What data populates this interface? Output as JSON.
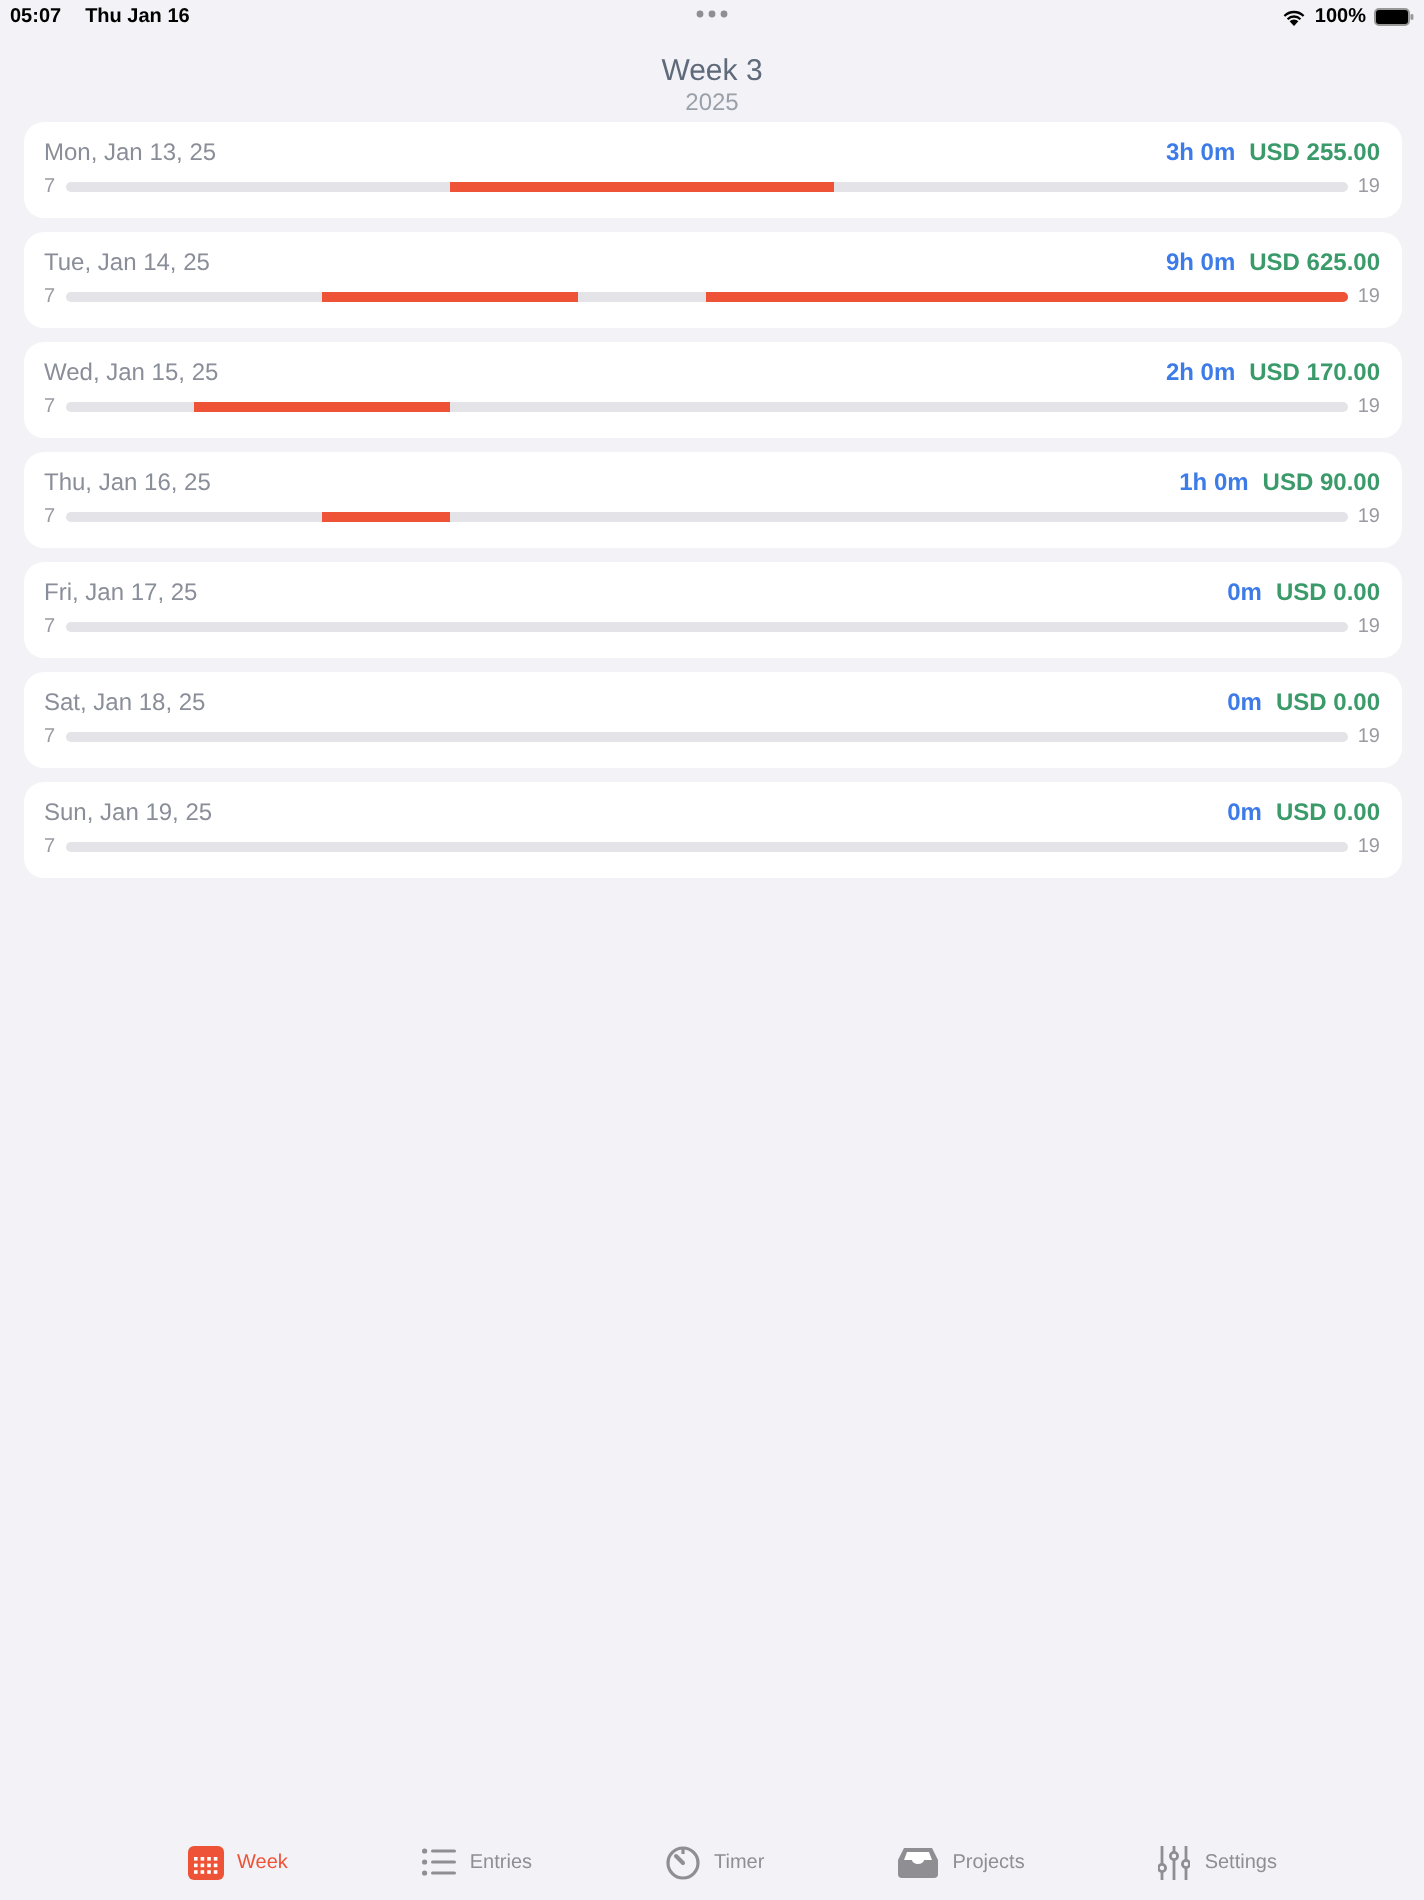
{
  "status_bar": {
    "time": "05:07",
    "date": "Thu Jan 16",
    "battery": "100%"
  },
  "header": {
    "title": "Week 3",
    "year": "2025"
  },
  "days": [
    {
      "date": "Mon, Jan 13, 25",
      "duration": "3h 0m",
      "amount": "USD 255.00",
      "start": "7",
      "end": "19",
      "slots": [
        false,
        false,
        false,
        true,
        true,
        true,
        false,
        false,
        false,
        false
      ]
    },
    {
      "date": "Tue, Jan 14, 25",
      "duration": "9h 0m",
      "amount": "USD 625.00",
      "start": "7",
      "end": "19",
      "slots": [
        false,
        false,
        true,
        true,
        false,
        true,
        true,
        true,
        true,
        true
      ]
    },
    {
      "date": "Wed, Jan 15, 25",
      "duration": "2h 0m",
      "amount": "USD 170.00",
      "start": "7",
      "end": "19",
      "slots": [
        false,
        true,
        true,
        false,
        false,
        false,
        false,
        false,
        false,
        false
      ]
    },
    {
      "date": "Thu, Jan 16, 25",
      "duration": "1h 0m",
      "amount": "USD 90.00",
      "start": "7",
      "end": "19",
      "slots": [
        false,
        false,
        true,
        false,
        false,
        false,
        false,
        false,
        false,
        false
      ]
    },
    {
      "date": "Fri, Jan 17, 25",
      "duration": "0m",
      "amount": "USD 0.00",
      "start": "7",
      "end": "19",
      "slots": [
        false,
        false,
        false,
        false,
        false,
        false,
        false,
        false,
        false,
        false
      ]
    },
    {
      "date": "Sat, Jan 18, 25",
      "duration": "0m",
      "amount": "USD 0.00",
      "start": "7",
      "end": "19",
      "slots": [
        false,
        false,
        false,
        false,
        false,
        false,
        false,
        false,
        false,
        false
      ]
    },
    {
      "date": "Sun, Jan 19, 25",
      "duration": "0m",
      "amount": "USD 0.00",
      "start": "7",
      "end": "19",
      "slots": [
        false,
        false,
        false,
        false,
        false,
        false,
        false,
        false,
        false,
        false
      ]
    }
  ],
  "tabs": [
    {
      "kind": "calendar",
      "label": "Week",
      "selected": true
    },
    {
      "kind": "list",
      "label": "Entries",
      "selected": false
    },
    {
      "kind": "timer",
      "label": "Timer",
      "selected": false
    },
    {
      "kind": "tray",
      "label": "Projects",
      "selected": false
    },
    {
      "kind": "sliders",
      "label": "Settings",
      "selected": false
    }
  ]
}
